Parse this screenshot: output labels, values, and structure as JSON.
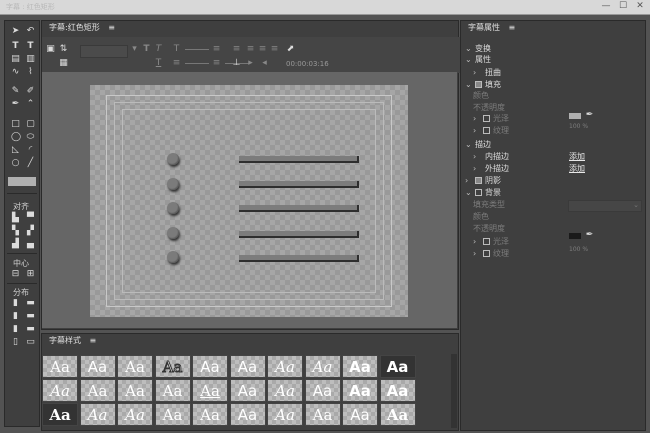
{
  "titlebar": {
    "title": "字幕 : 红色矩形",
    "min": "—",
    "max": "☐",
    "close": "✕"
  },
  "tools": {
    "align_label": "对齐",
    "center_label": "中心",
    "distribute_label": "分布"
  },
  "editor": {
    "tab_label": "字幕:红色矩形",
    "menu_icon": "≡",
    "timecode": "00:00:03:16"
  },
  "styles_panel": {
    "title": "字幕样式",
    "menu_icon": "≡",
    "swatches": [
      "Aa",
      "Aa",
      "Aa",
      "Aa",
      "Aa",
      "Aa",
      "Aa",
      "Aa",
      "Aa",
      "Aa",
      "Aa",
      "Aa",
      "Aa",
      "Aa",
      "Aa",
      "Aa",
      "Aa",
      "Aa",
      "Aa",
      "Aa",
      "Aa",
      "Aa",
      "Aa",
      "Aa",
      "Aa",
      "Aa",
      "Aa",
      "Aa",
      "Aa",
      "Aa"
    ]
  },
  "props": {
    "title": "字幕属性",
    "menu_icon": "≡",
    "transform": "变换",
    "attributes": "属性",
    "distort": "扭曲",
    "fill": "填充",
    "color": "颜色",
    "opacity": "不透明度",
    "opacity_val": "100 %",
    "sheen": "光泽",
    "texture": "纹理",
    "stroke": "描边",
    "inner_stroke": "内描边",
    "outer_stroke": "外描边",
    "add": "添加",
    "shadow": "阴影",
    "background": "背景",
    "fill_type": "填充类型",
    "bg_color": "颜色",
    "bg_opacity": "不透明度",
    "bg_opacity_val": "100 %",
    "bg_sheen": "光泽",
    "bg_texture": "纹理"
  },
  "colors": {
    "fill_swatch": "#b0b0b0",
    "bg_swatch": "#1a1a1a"
  }
}
